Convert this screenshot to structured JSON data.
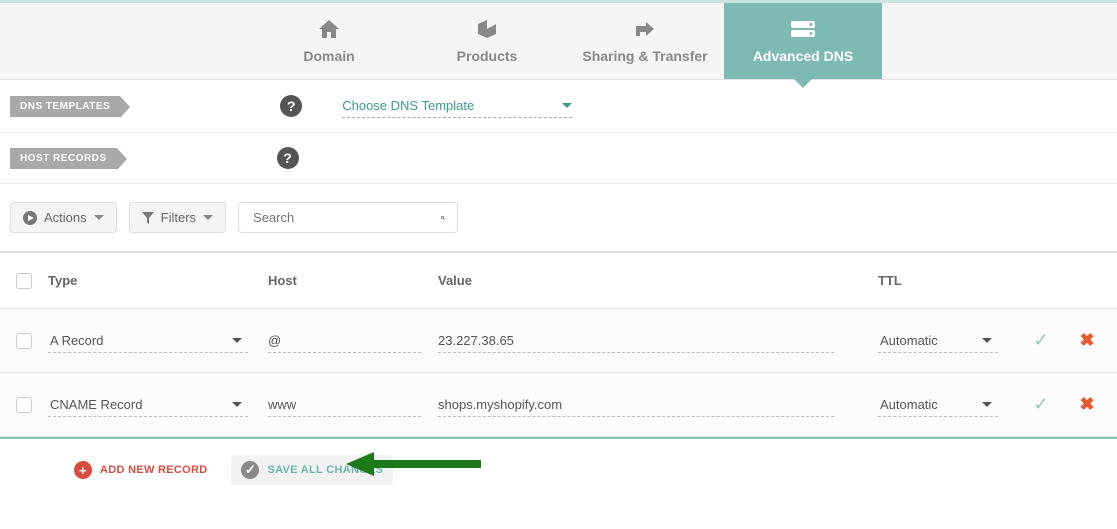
{
  "tabs": {
    "domain": "Domain",
    "products": "Products",
    "sharing": "Sharing & Transfer",
    "advanced": "Advanced DNS"
  },
  "sections": {
    "dns_templates": "DNS TEMPLATES",
    "host_records": "HOST RECORDS",
    "choose_template": "Choose DNS Template"
  },
  "toolbar": {
    "actions": "Actions",
    "filters": "Filters",
    "search_placeholder": "Search"
  },
  "columns": {
    "type": "Type",
    "host": "Host",
    "value": "Value",
    "ttl": "TTL"
  },
  "rows": [
    {
      "type": "A Record",
      "host": "@",
      "value": "23.227.38.65",
      "ttl": "Automatic"
    },
    {
      "type": "CNAME Record",
      "host": "www",
      "value": "shops.myshopify.com",
      "ttl": "Automatic"
    }
  ],
  "buttons": {
    "add_new": "ADD NEW RECORD",
    "save_all": "SAVE ALL CHANGES"
  }
}
